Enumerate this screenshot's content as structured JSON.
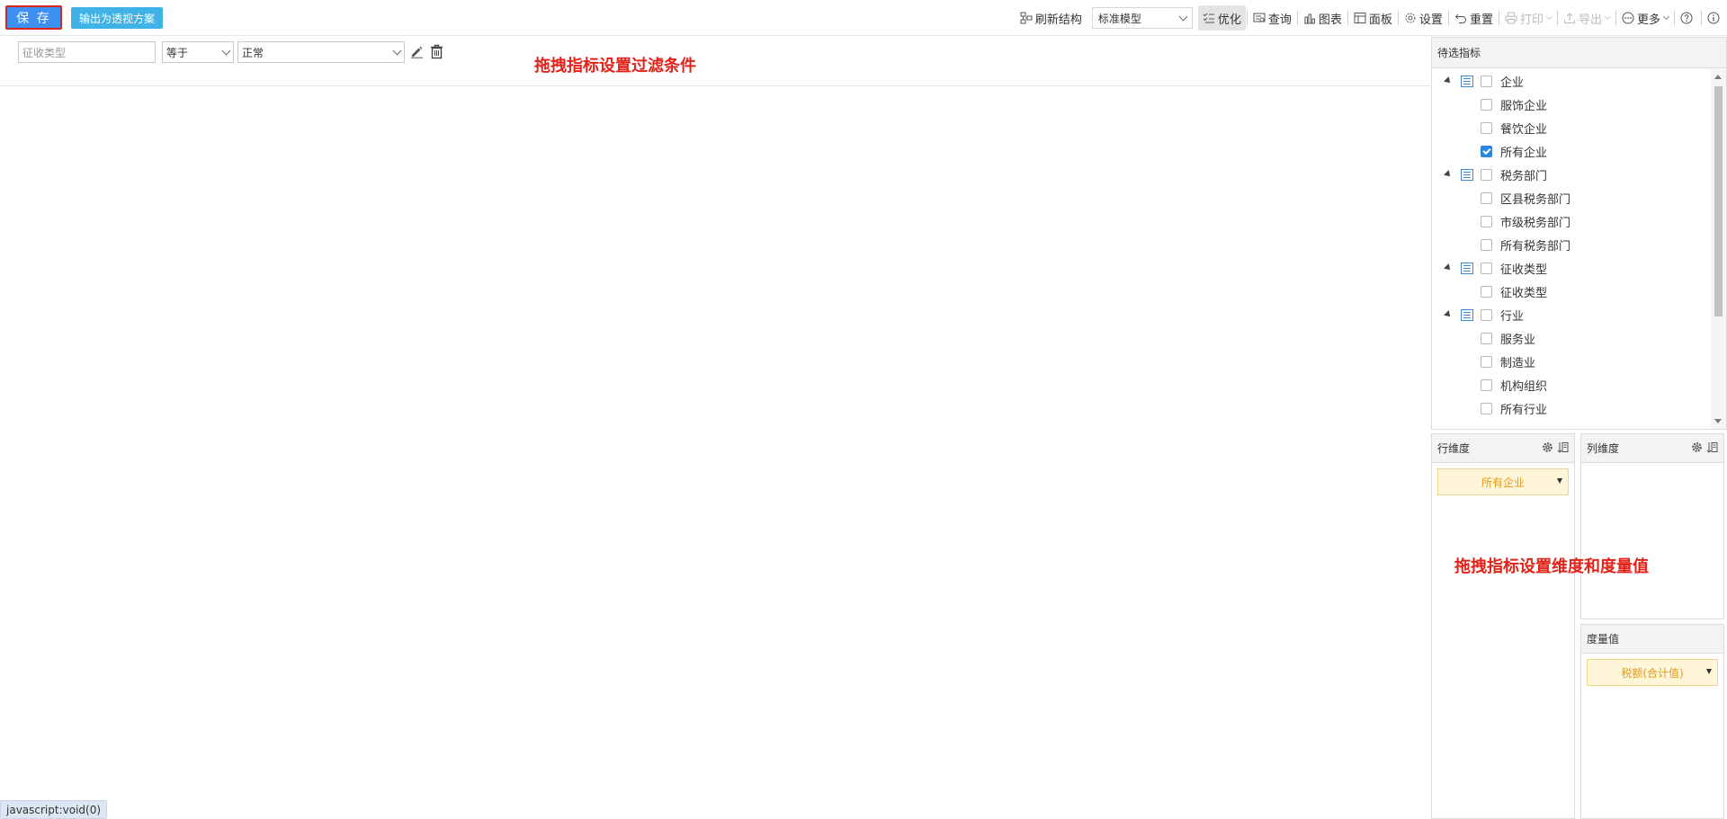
{
  "toolbar": {
    "save_label": "保 存",
    "export_pivot_label": "输出为透视方案",
    "refresh_structure_label": "刷新结构",
    "model_select_value": "标准模型",
    "optimize_label": "优化",
    "query_label": "查询",
    "chart_label": "图表",
    "panel_label": "面板",
    "settings_label": "设置",
    "reset_label": "重置",
    "print_label": "打印",
    "export_label": "导出",
    "more_label": "更多"
  },
  "filter": {
    "field_placeholder": "征收类型",
    "operator_value": "等于",
    "value_value": "正常",
    "annotation": "拖拽指标设置过滤条件"
  },
  "candidate_panel": {
    "title": "待选指标",
    "groups": [
      {
        "label": "企业",
        "children": [
          {
            "label": "服饰企业",
            "checked": false
          },
          {
            "label": "餐饮企业",
            "checked": false
          },
          {
            "label": "所有企业",
            "checked": true
          }
        ]
      },
      {
        "label": "税务部门",
        "children": [
          {
            "label": "区县税务部门",
            "checked": false
          },
          {
            "label": "市级税务部门",
            "checked": false
          },
          {
            "label": "所有税务部门",
            "checked": false
          }
        ]
      },
      {
        "label": "征收类型",
        "children": [
          {
            "label": "征收类型",
            "checked": false
          }
        ]
      },
      {
        "label": "行业",
        "children": [
          {
            "label": "服务业",
            "checked": false
          },
          {
            "label": "制造业",
            "checked": false
          },
          {
            "label": "机构组织",
            "checked": false
          },
          {
            "label": "所有行业",
            "checked": false
          }
        ]
      }
    ]
  },
  "row_dimension": {
    "title": "行维度",
    "chip": "所有企业"
  },
  "column_dimension": {
    "title": "列维度"
  },
  "measure": {
    "title": "度量值",
    "chip": "税额(合计值)"
  },
  "dimension_annotation": "拖拽指标设置维度和度量值",
  "statusbar": "javascript:void(0)"
}
